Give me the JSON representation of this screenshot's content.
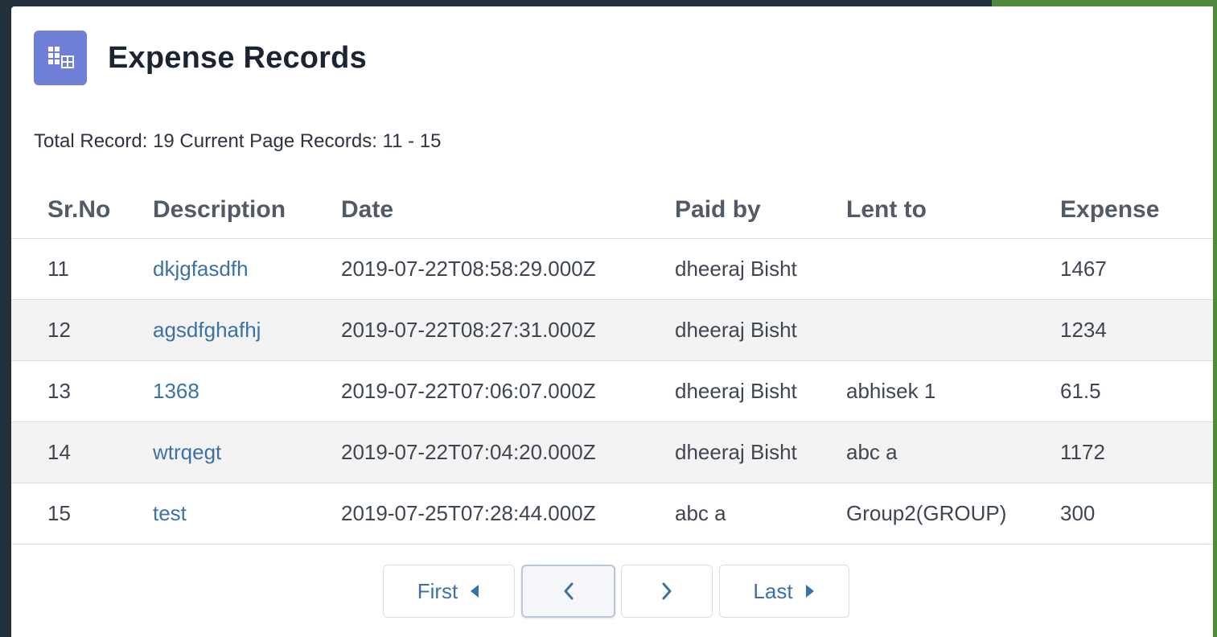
{
  "header": {
    "title": "Expense Records",
    "icon": "table-icon",
    "icon_color": "#6f7fd8"
  },
  "summary": "Total Record: 19 Current Page Records: 11 - 15",
  "table": {
    "columns": [
      "Sr.No",
      "Description",
      "Date",
      "Paid by",
      "Lent to",
      "Expense"
    ],
    "rows": [
      {
        "srno": "11",
        "description": "dkjgfasdfh",
        "date": "2019-07-22T08:58:29.000Z",
        "paid_by": "dheeraj Bisht",
        "lent_to": "",
        "expense": "1467"
      },
      {
        "srno": "12",
        "description": "agsdfghafhj",
        "date": "2019-07-22T08:27:31.000Z",
        "paid_by": "dheeraj Bisht",
        "lent_to": "",
        "expense": "1234"
      },
      {
        "srno": "13",
        "description": "1368",
        "date": "2019-07-22T07:06:07.000Z",
        "paid_by": "dheeraj Bisht",
        "lent_to": "abhisek 1",
        "expense": "61.5"
      },
      {
        "srno": "14",
        "description": "wtrqegt",
        "date": "2019-07-22T07:04:20.000Z",
        "paid_by": "dheeraj Bisht",
        "lent_to": "abc a",
        "expense": "1172"
      },
      {
        "srno": "15",
        "description": "test",
        "date": "2019-07-25T07:28:44.000Z",
        "paid_by": "abc a",
        "lent_to": "Group2(GROUP)",
        "expense": "300"
      }
    ]
  },
  "pagination": {
    "first_label": "First",
    "last_label": "Last",
    "icons": [
      "caret-left-icon",
      "chevron-left-icon",
      "chevron-right-icon",
      "caret-right-icon"
    ]
  },
  "colors": {
    "link": "#3a72a8",
    "accent_green": "#4f8a3c",
    "frame_dark": "#232f3a"
  }
}
